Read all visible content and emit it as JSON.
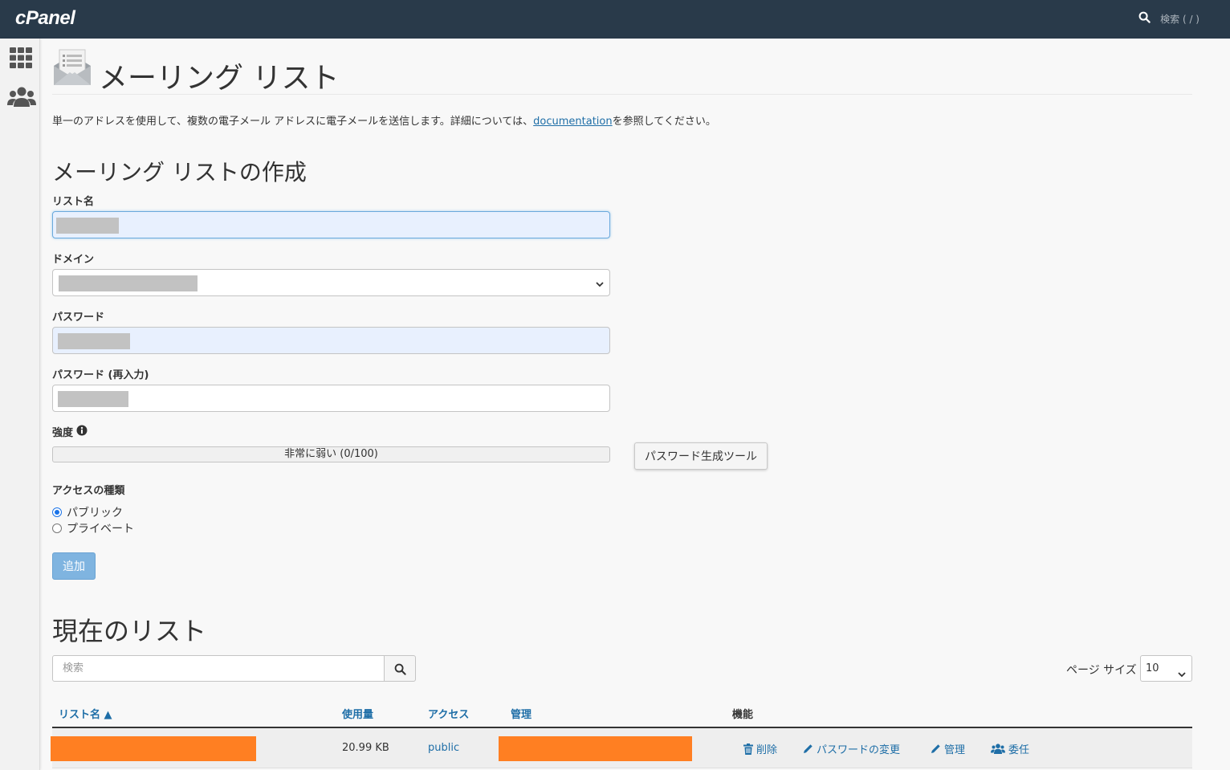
{
  "topbar": {
    "logo": "cPanel",
    "search_label": "検索 ( / )",
    "search_icon": "search-icon"
  },
  "sidebar": {
    "items": [
      {
        "icon": "grid-icon"
      },
      {
        "icon": "users-icon"
      }
    ]
  },
  "page": {
    "icon": "mailing-list-icon",
    "title": "メーリング リスト",
    "description_before": "単一のアドレスを使用して、複数の電子メール アドレスに電子メールを送信します。詳細については、",
    "description_link": "documentation",
    "description_after": "を参照してください。"
  },
  "create_form": {
    "title": "メーリング リストの作成",
    "list_name_label": "リスト名",
    "domain_label": "ドメイン",
    "password_label": "パスワード",
    "password_confirm_label": "パスワード (再入力)",
    "strength_label": "強度",
    "strength_value": "非常に弱い (0/100)",
    "generator_button": "パスワード生成ツール",
    "access_label": "アクセスの種類",
    "access_options": [
      {
        "label": "パブリック",
        "checked": true
      },
      {
        "label": "プライベート",
        "checked": false
      }
    ],
    "add_button": "追加"
  },
  "current_lists": {
    "title": "現在のリスト",
    "search_placeholder": "検索",
    "page_size_label": "ページ サイズ",
    "page_size_value": "10",
    "columns": {
      "list_name": "リスト名",
      "usage": "使用量",
      "access": "アクセス",
      "admin": "管理",
      "functions": "機能"
    },
    "sort_indicator": "▲",
    "rows": [
      {
        "usage": "20.99 KB",
        "access": "public",
        "actions": {
          "delete": "削除",
          "change_password": "パスワードの変更",
          "manage": "管理",
          "delegate": "委任"
        }
      }
    ]
  },
  "colors": {
    "topbar": "#293a4a",
    "link": "#1e6ea7",
    "redaction": "#ff7f22",
    "add_button": "#7fb4e0"
  }
}
